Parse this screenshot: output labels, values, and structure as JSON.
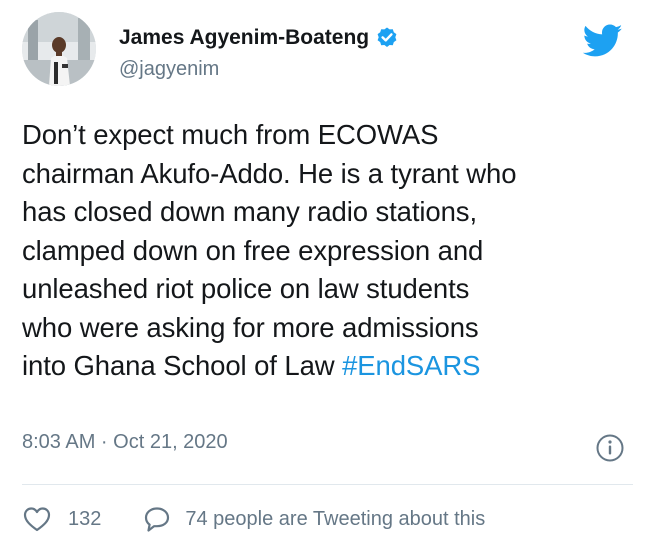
{
  "tweet": {
    "author_name": "James Agyenim-Boateng",
    "author_handle": "@jagyenim",
    "verified": true,
    "text_lines": [
      "Don’t expect much from ECOWAS",
      "chairman Akufo-Addo. He is a tyrant who",
      "has closed down many radio stations,",
      "clamped down on free expression and",
      "unleashed riot police on law students",
      "who were asking for more admissions",
      "into Ghana School of Law "
    ],
    "hashtag": "#EndSARS",
    "timestamp": "8:03 AM · Oct 21, 2020",
    "like_count": "132",
    "conversation_text": "74 people are Tweeting about this"
  },
  "icons": {
    "logo": "twitter-bird-icon",
    "verified": "verified-badge-icon",
    "info": "info-icon",
    "like": "heart-icon",
    "reply": "speech-bubble-icon"
  },
  "colors": {
    "brand_blue": "#1da1f2",
    "link_blue": "#1b95e0",
    "text": "#14171a",
    "secondary_text": "#657786",
    "divider": "#e1e8ed"
  }
}
